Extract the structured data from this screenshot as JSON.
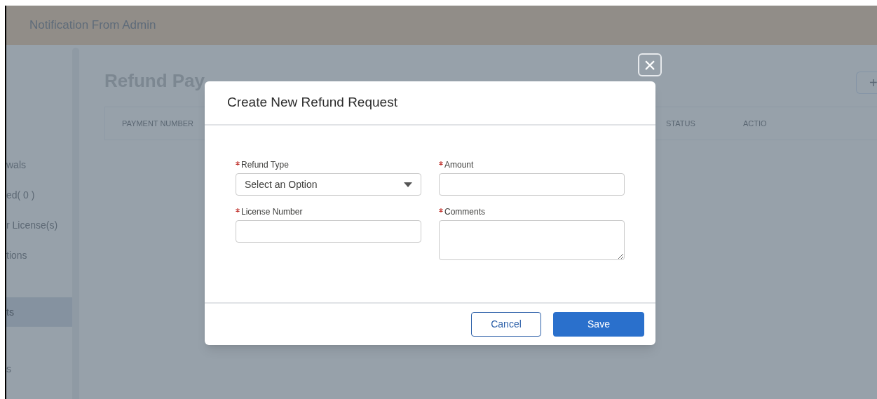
{
  "header": {
    "title": "Notification From Admin"
  },
  "sidebar": {
    "items": [
      {
        "label": "wals",
        "selected": false
      },
      {
        "label": "ed( 0 )",
        "selected": false
      },
      {
        "label": "r License(s)",
        "selected": false
      },
      {
        "label": "tions",
        "selected": false
      },
      {
        "label": "ts",
        "selected": true
      },
      {
        "label": "s",
        "selected": false
      }
    ]
  },
  "page": {
    "title": "Refund Pay",
    "add_button": "+",
    "table": {
      "columns": [
        "PAYMENT NUMBER",
        "STATUS",
        "ACTIO"
      ]
    }
  },
  "modal": {
    "close": "×",
    "title": "Create New Refund Request",
    "fields": [
      {
        "kind": "select",
        "label": "Refund Type",
        "required": true,
        "placeholder": "Select an Option"
      },
      {
        "kind": "text",
        "label": "Amount",
        "required": true
      },
      {
        "kind": "text",
        "label": "License Number",
        "required": true
      },
      {
        "kind": "textarea",
        "label": "Comments",
        "required": true
      }
    ],
    "buttons": [
      {
        "label": "Cancel",
        "kind": "secondary"
      },
      {
        "label": "Save",
        "kind": "primary"
      }
    ]
  }
}
